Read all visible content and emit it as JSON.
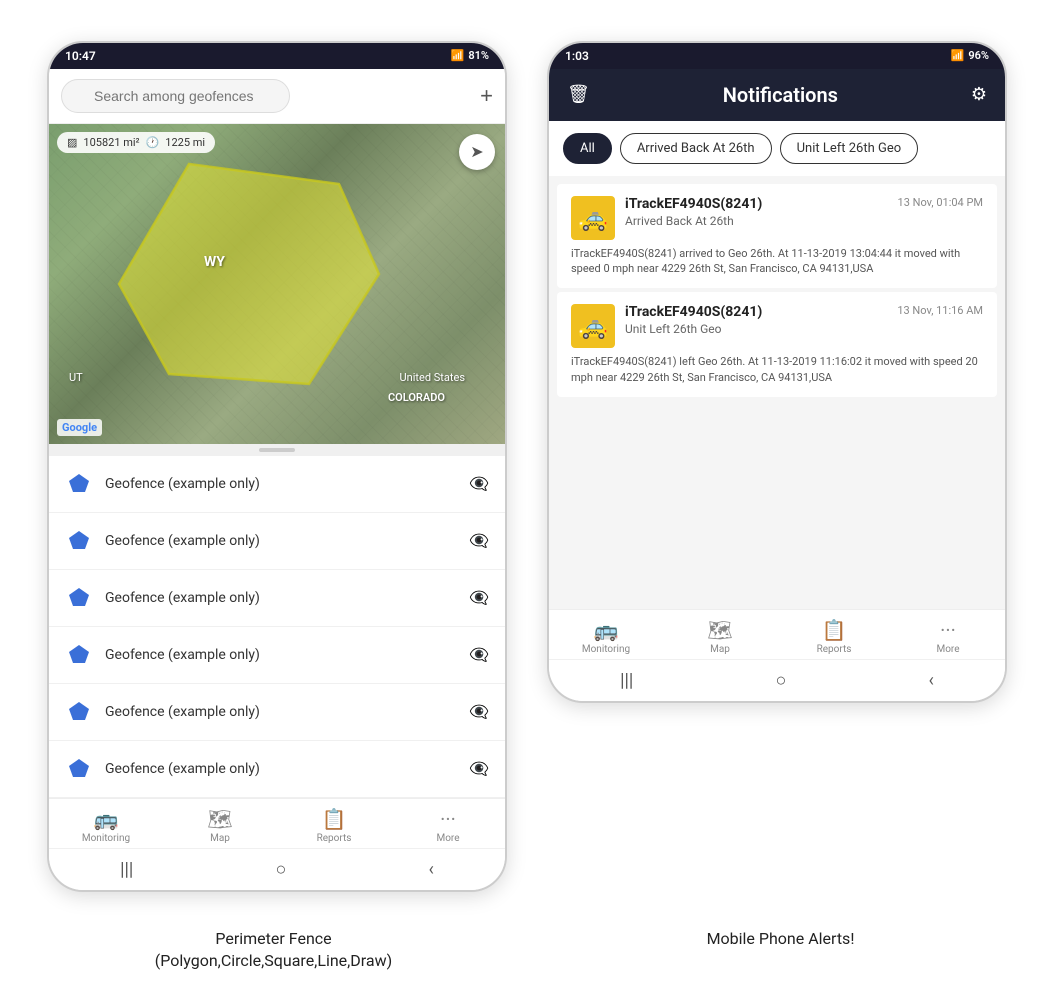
{
  "left_phone": {
    "status_bar": {
      "time": "10:47",
      "signal": "WiFi",
      "battery": "81%"
    },
    "search": {
      "placeholder": "Search among geofences"
    },
    "map": {
      "stats_area": "105821 mi²",
      "stats_distance": "1225 mi",
      "label_wy": "WY",
      "label_us": "United States",
      "label_colorado": "COLORADO",
      "label_ut": "UT",
      "google": "Google"
    },
    "geofences": [
      {
        "label": "Geofence (example only)"
      },
      {
        "label": "Geofence (example only)"
      },
      {
        "label": "Geofence (example only)"
      },
      {
        "label": "Geofence (example only)"
      },
      {
        "label": "Geofence (example only)"
      },
      {
        "label": "Geofence (example only)"
      }
    ],
    "bottom_nav": [
      {
        "label": "Monitoring",
        "icon": "🚌"
      },
      {
        "label": "Map",
        "icon": "🗺"
      },
      {
        "label": "Reports",
        "icon": "📋"
      },
      {
        "label": "More",
        "icon": "···"
      }
    ],
    "caption": "Perimeter Fence\n(Polygon,Circle,Square,Line,Draw)"
  },
  "right_phone": {
    "status_bar": {
      "time": "1:03",
      "battery": "96%"
    },
    "header": {
      "title": "Notifications"
    },
    "filters": [
      {
        "label": "All",
        "active": true
      },
      {
        "label": "Arrived Back At 26th",
        "active": false
      },
      {
        "label": "Unit Left 26th Geo",
        "active": false
      }
    ],
    "notifications": [
      {
        "device": "iTrackEF4940S(8241)",
        "time": "13 Nov, 01:04 PM",
        "event": "Arrived Back At 26th",
        "body": "iTrackEF4940S(8241) arrived to Geo 26th.    At 11-13-2019 13:04:44 it moved with speed 0 mph near 4229 26th St, San Francisco, CA 94131,USA"
      },
      {
        "device": "iTrackEF4940S(8241)",
        "time": "13 Nov, 11:16 AM",
        "event": "Unit Left 26th Geo",
        "body": "iTrackEF4940S(8241) left Geo 26th.    At 11-13-2019 11:16:02 it moved with speed 20 mph near 4229 26th St, San Francisco, CA 94131,USA"
      }
    ],
    "bottom_nav": [
      {
        "label": "Monitoring",
        "icon": "🚌"
      },
      {
        "label": "Map",
        "icon": "🗺"
      },
      {
        "label": "Reports",
        "icon": "📋"
      },
      {
        "label": "More",
        "icon": "···"
      }
    ],
    "caption": "Mobile Phone Alerts!"
  }
}
